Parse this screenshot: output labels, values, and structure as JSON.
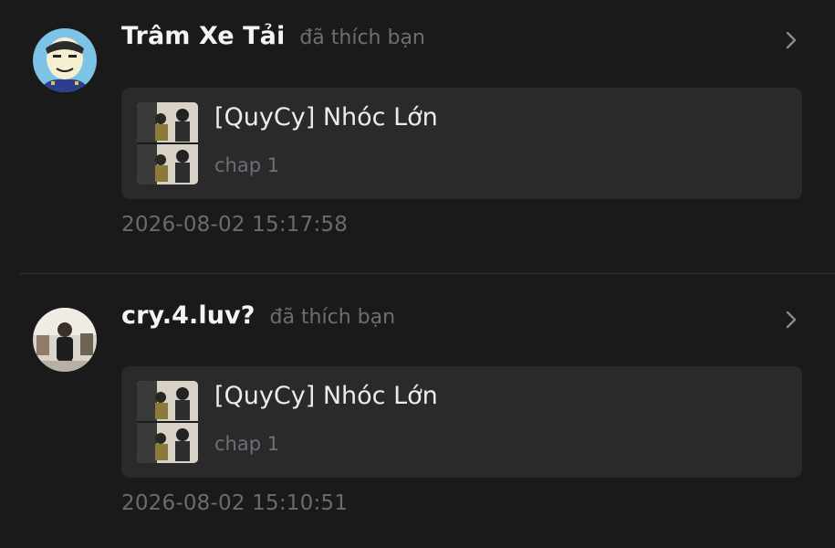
{
  "notifications": [
    {
      "username": "Trâm Xe Tải",
      "action": "đã thích bạn",
      "avatar_icon": "cartoon-avatar-icon",
      "card": {
        "title": "[QuyCy] Nhóc Lớn",
        "subtitle": "chap 1",
        "thumbnail_icon": "manga-cover-thumbnail"
      },
      "timestamp": "2026-08-02 15:17:58"
    },
    {
      "username": "cry.4.luv?",
      "action": "đã thích bạn",
      "avatar_icon": "photo-avatar-icon",
      "card": {
        "title": "[QuyCy] Nhóc Lớn",
        "subtitle": "chap 1",
        "thumbnail_icon": "manga-cover-thumbnail"
      },
      "timestamp": "2026-08-02 15:10:51"
    }
  ],
  "colors": {
    "background": "#1a1a1b",
    "card": "#2a2a2c",
    "username": "#f4f4f4",
    "muted": "#6e6e72",
    "divider": "#343436"
  }
}
